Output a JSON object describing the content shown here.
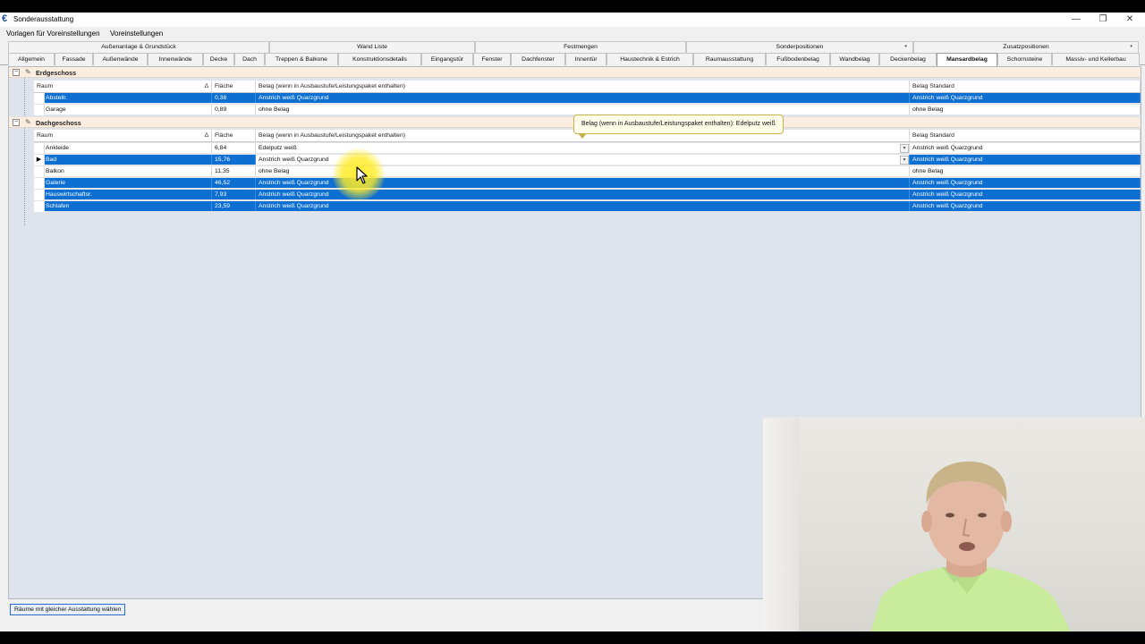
{
  "window": {
    "title": "Sonderausstattung",
    "app_icon": "€",
    "minimize": "—",
    "restore": "❐",
    "close": "✕"
  },
  "menu": [
    "Vorlagen für Voreinstellungen",
    "Voreinstellungen"
  ],
  "tabs_top": [
    {
      "label": "Außenanlage & Grundstück"
    },
    {
      "label": "Wand Liste"
    },
    {
      "label": "Festmengen"
    },
    {
      "label": "Sonderpositionen"
    },
    {
      "label": "Zusatzpositionen"
    }
  ],
  "tabs": [
    "Allgemein",
    "Fassade",
    "Außenwände",
    "Innenwände",
    "Decke",
    "Dach",
    "Treppen & Balkone",
    "Konstruktionsdetails",
    "Eingangstür",
    "Fenster",
    "Dachfenster",
    "Innentür",
    "Haustechnik & Estrich",
    "Raumausstattung",
    "Fußbodenbelag",
    "Wandbelag",
    "Deckenbelag",
    "Mansardbelag",
    "Schornsteine",
    "Massiv- und Kellerbau"
  ],
  "active_tab": "Mansardbelag",
  "columns": {
    "raum": "Raum",
    "flaeche": "Fläche",
    "belag": "Belag (wenn in Ausbaustufe/Leistungspaket enthalten)",
    "standard": "Belag Standard"
  },
  "groups": [
    {
      "name": "Erdgeschoss",
      "rows": [
        {
          "raum": "Abstellr.",
          "flaeche": "0,38",
          "belag": "Anstrich weiß Quarzgrund",
          "standard": "Anstrich weiß Quarzgrund",
          "selected": true
        },
        {
          "raum": "Garage",
          "flaeche": "0,89",
          "belag": "ohne Belag",
          "standard": "ohne Belag",
          "selected": false
        }
      ]
    },
    {
      "name": "Dachgeschoss",
      "rows": [
        {
          "raum": "Ankleide",
          "flaeche": "6,84",
          "belag": "Edelputz weiß",
          "standard": "Anstrich weiß Quarzgrund",
          "selected": false
        },
        {
          "raum": "Bad",
          "flaeche": "15,76",
          "belag": "Anstrich weiß Quarzgrund",
          "standard": "Anstrich weiß Quarzgrund",
          "selected": true,
          "current": true
        },
        {
          "raum": "Balkon",
          "flaeche": "11,35",
          "belag": "ohne Belag",
          "standard": "ohne Belag",
          "selected": false
        },
        {
          "raum": "Galerie",
          "flaeche": "46,52",
          "belag": "Anstrich weiß Quarzgrund",
          "standard": "Anstrich weiß Quarzgrund",
          "selected": true
        },
        {
          "raum": "Hauswirtschaftsr.",
          "flaeche": "7,93",
          "belag": "Anstrich weiß Quarzgrund",
          "standard": "Anstrich weiß Quarzgrund",
          "selected": true
        },
        {
          "raum": "Schlafen",
          "flaeche": "23,59",
          "belag": "Anstrich weiß Quarzgrund",
          "standard": "Anstrich weiß Quarzgrund",
          "selected": true
        }
      ]
    }
  ],
  "tooltip": "Belag (wenn in Ausbaustufe/Leistungspaket enthalten): Edelputz weiß",
  "bottom_button": "Räume mit gleicher Ausstattung wählen",
  "icons": {
    "expander": "minus-box-icon",
    "edit": "pencil-icon",
    "sort": "sort-ascending-icon",
    "row_indicator": "current-row-icon",
    "dropdown": "chevron-down-icon"
  },
  "colors": {
    "selection": "#0c6fd1",
    "group_header": "#fbeee0",
    "tooltip_bg": "#fffce8",
    "cursor_highlight": "#ffec28"
  }
}
